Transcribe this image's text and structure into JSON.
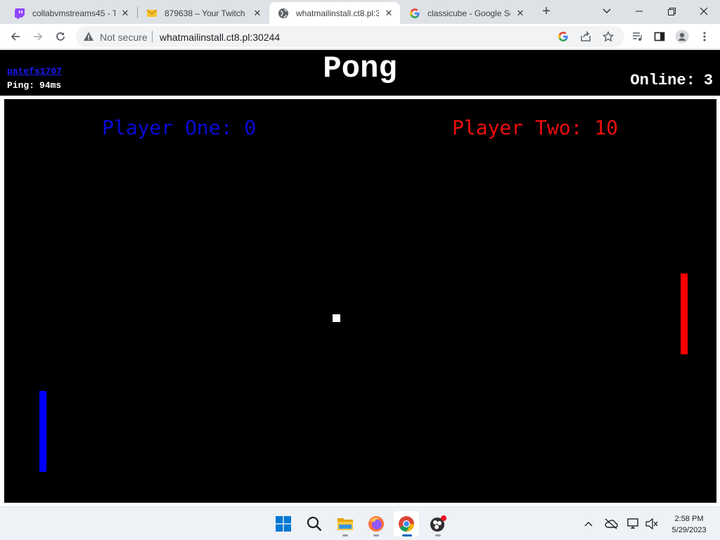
{
  "browser": {
    "tabs": [
      {
        "title": "collabvmstreams45 - Tw",
        "icon": "twitch-icon"
      },
      {
        "title": "879638 – Your Twitch V",
        "icon": "mail-icon"
      },
      {
        "title": "whatmailinstall.ct8.pl:3",
        "icon": "globe-icon"
      },
      {
        "title": "classicube - Google Se",
        "icon": "google-icon"
      }
    ],
    "active_tab_index": 2,
    "security_label": "Not secure",
    "url": "whatmailinstall.ct8.pl:30244"
  },
  "page": {
    "username": "patefs1707",
    "ping_label": "Ping:",
    "ping_value": "94ms",
    "title": "Pong",
    "online_label": "Online:",
    "online_count": "3"
  },
  "game": {
    "player_one": {
      "label": "Player One:",
      "score": "0",
      "color": "#0a0ad8"
    },
    "player_two": {
      "label": "Player Two:",
      "score": "10",
      "color": "#ee0d0d"
    },
    "paddle_left_color": "#0000ff",
    "paddle_right_color": "#ff0000",
    "ball_color": "#ffffff"
  },
  "taskbar": {
    "apps": [
      "start-icon",
      "search-icon",
      "file-explorer-icon",
      "firefox-icon",
      "chrome-icon",
      "obs-icon"
    ],
    "time": "2:58 PM",
    "date": "5/29/2023"
  }
}
